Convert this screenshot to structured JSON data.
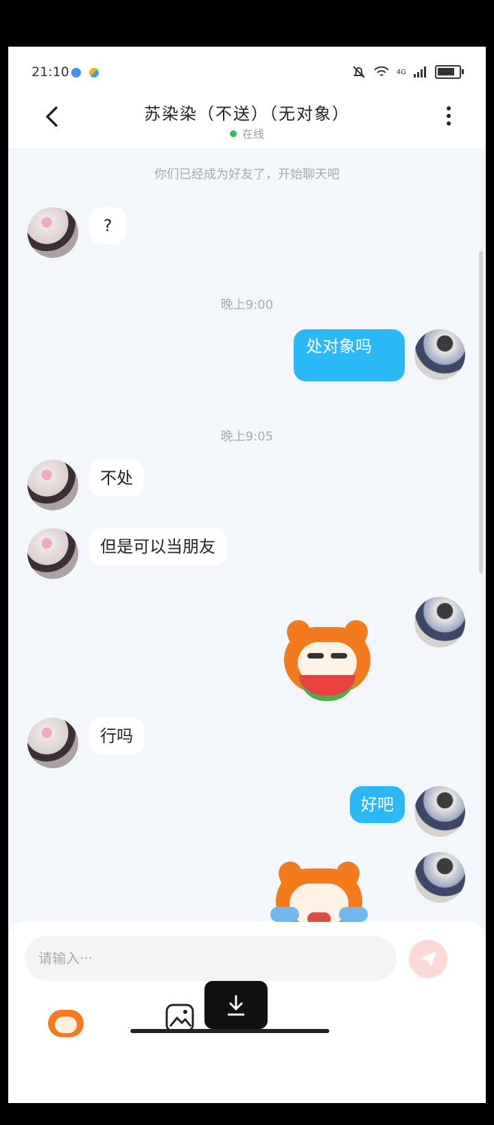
{
  "status_bar": {
    "time": "21:10",
    "network": "4G"
  },
  "header": {
    "title": "苏染染（不送）（无对象）",
    "status": "在线"
  },
  "messages": {
    "system_friend": "你们已经成为好友了，开始聊天吧",
    "time1": "晚上9:00",
    "time2": "晚上9:05",
    "m1": "?",
    "m2": "处对象吗",
    "m3": "不处",
    "m4": "但是可以当朋友",
    "m5": "行吗",
    "m6": "好吧"
  },
  "composer": {
    "placeholder": "请输入···"
  },
  "icons": [
    "back-icon",
    "more-icon",
    "send-icon",
    "emoji-icon",
    "image-icon",
    "download-icon"
  ],
  "colors": {
    "accent": "#2ab8f6",
    "online": "#2ec15a",
    "send_disabled": "#ffd9d7"
  }
}
